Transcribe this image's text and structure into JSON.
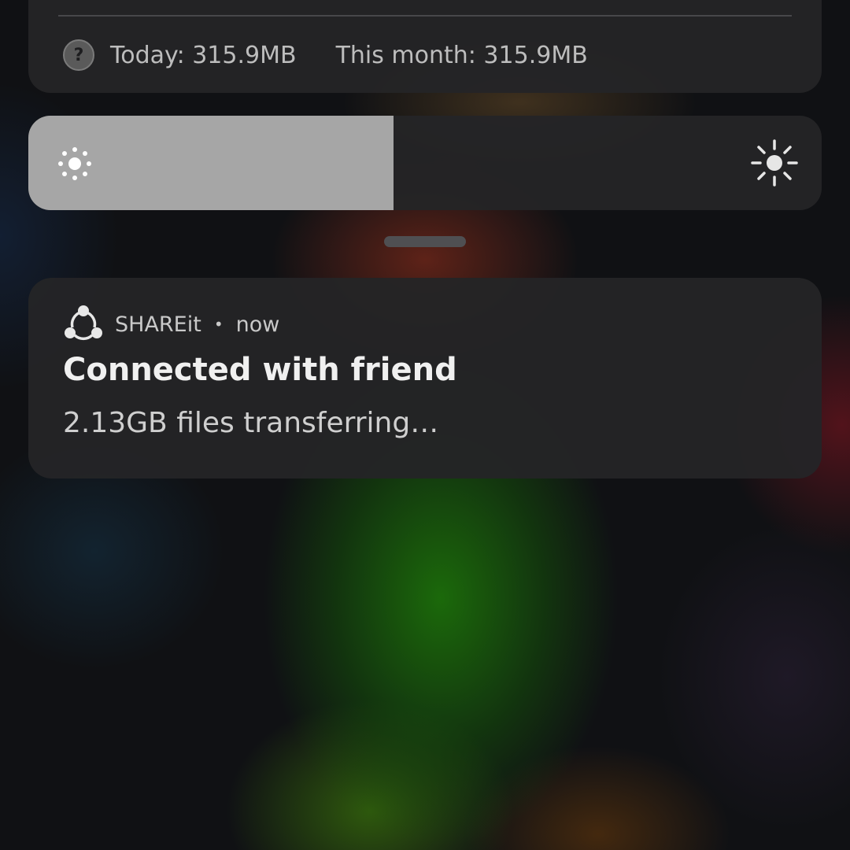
{
  "data_usage": {
    "help_icon": "question-mark-circle-icon",
    "today": "Today: 315.9MB",
    "month": "This month: 315.9MB"
  },
  "brightness": {
    "level": 0.46,
    "low_icon": "brightness-low-icon",
    "high_icon": "brightness-high-icon",
    "fill_color": "#a6a6a6"
  },
  "notification": {
    "app_icon": "shareit-icon",
    "app_name": "SHAREit",
    "separator": "•",
    "time": "now",
    "title": "Connected with friend",
    "text": "2.13GB files transferring…"
  }
}
